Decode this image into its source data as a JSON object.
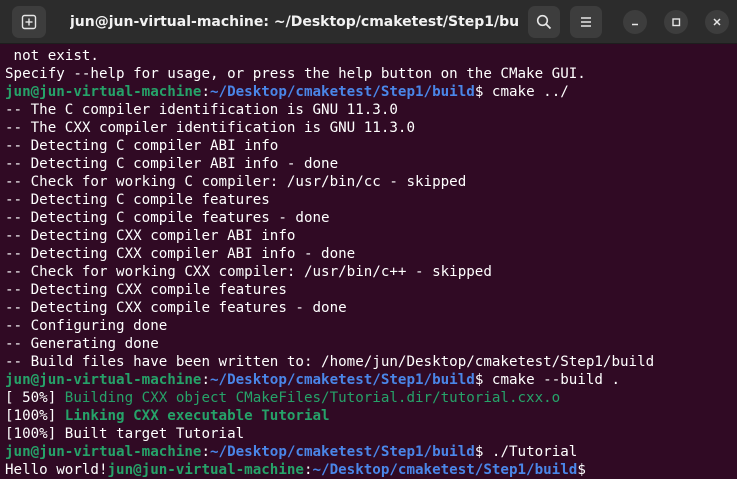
{
  "window": {
    "title": "jun@jun-virtual-machine: ~/Desktop/cmaketest/Step1/build"
  },
  "icons": {
    "new_tab": "new-tab-icon",
    "search": "search-icon",
    "menu": "hamburger-menu-icon",
    "minimize": "minimize-icon",
    "maximize": "maximize-icon",
    "close": "close-icon"
  },
  "colors": {
    "background": "#300a24",
    "prompt_user": "#26a269",
    "prompt_path": "#4a86e8",
    "text": "#ffffff",
    "titlebar": "#2c2c2c"
  },
  "prompt": {
    "user": "jun@jun-virtual-machine",
    "sep": ":",
    "path": "~/Desktop/cmaketest/Step1/build",
    "symbol": "$"
  },
  "lines": [
    " not exist.",
    "Specify --help for usage, or press the help button on the CMake GUI.",
    "cmake ../",
    "-- The C compiler identification is GNU 11.3.0",
    "-- The CXX compiler identification is GNU 11.3.0",
    "-- Detecting C compiler ABI info",
    "-- Detecting C compiler ABI info - done",
    "-- Check for working C compiler: /usr/bin/cc - skipped",
    "-- Detecting C compile features",
    "-- Detecting C compile features - done",
    "-- Detecting CXX compiler ABI info",
    "-- Detecting CXX compiler ABI info - done",
    "-- Check for working CXX compiler: /usr/bin/c++ - skipped",
    "-- Detecting CXX compile features",
    "-- Detecting CXX compile features - done",
    "-- Configuring done",
    "-- Generating done",
    "-- Build files have been written to: /home/jun/Desktop/cmaketest/Step1/build",
    "cmake --build .",
    "[ 50%] ",
    "Building CXX object CMakeFiles/Tutorial.dir/tutorial.cxx.o",
    "[100%] ",
    "Linking CXX executable Tutorial",
    "[100%] Built target Tutorial",
    "./Tutorial",
    "Hello world!"
  ]
}
